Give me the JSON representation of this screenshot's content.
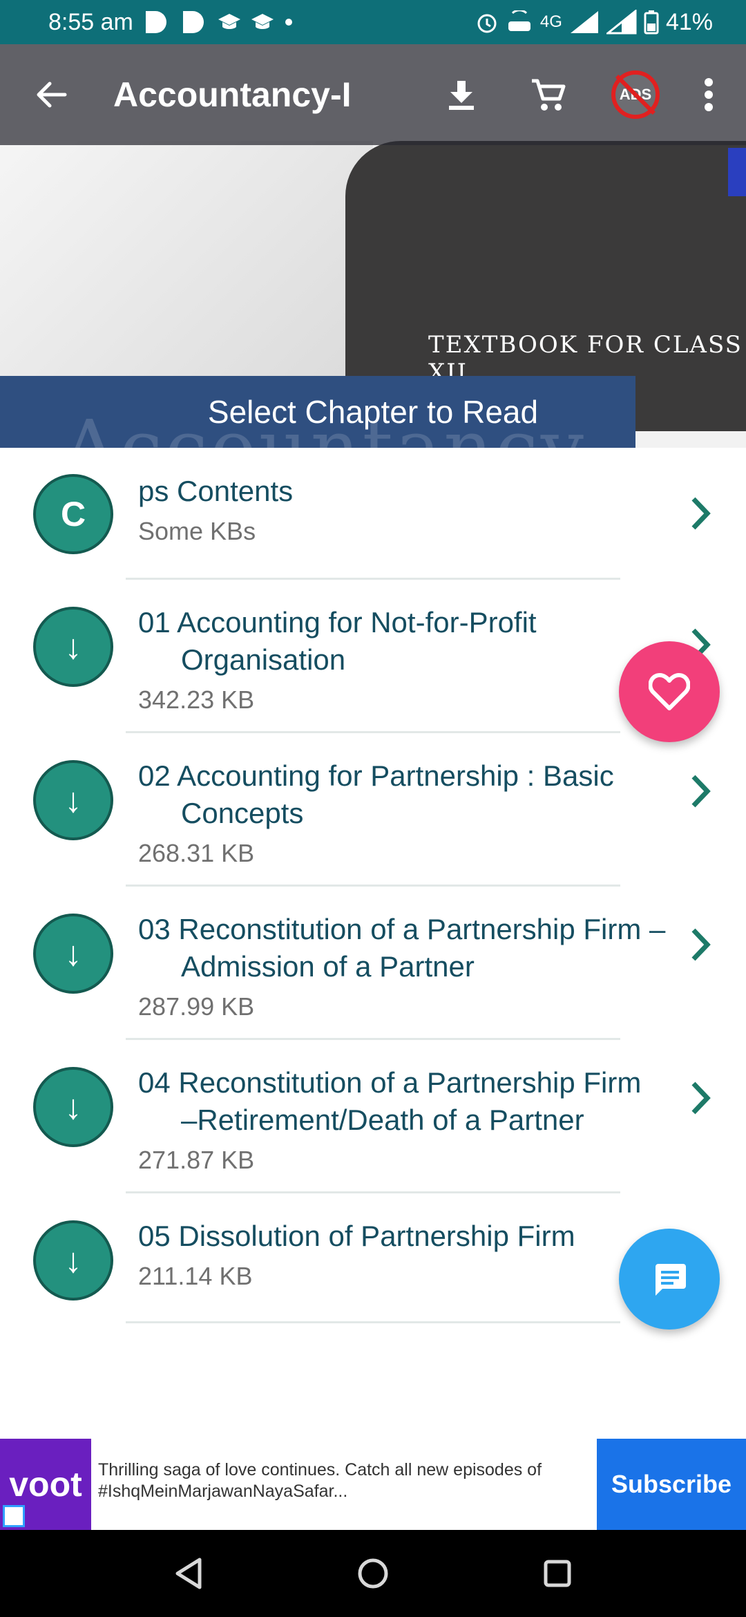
{
  "status_bar": {
    "time": "8:55 am",
    "battery": "41%",
    "network": "4G"
  },
  "toolbar": {
    "title": "Accountancy-I",
    "ads_label": "ADS"
  },
  "banner": {
    "caption": "TEXTBOOK FOR CLASS XII",
    "big_text": "Accountancy",
    "select_label": "Select Chapter to Read"
  },
  "chapters": [
    {
      "avatar": "C",
      "title": "ps Contents",
      "title_cont": "",
      "size": "Some KBs"
    },
    {
      "avatar": "↓",
      "title": "01 Accounting for Not-for-Profit",
      "title_cont": "Organisation",
      "size": "342.23 KB"
    },
    {
      "avatar": "↓",
      "title": "02 Accounting for Partnership : Basic",
      "title_cont": "Concepts",
      "size": "268.31 KB"
    },
    {
      "avatar": "↓",
      "title": "03 Reconstitution of a Partnership Firm –",
      "title_cont": "Admission of a Partner",
      "size": "287.99 KB"
    },
    {
      "avatar": "↓",
      "title": "04 Reconstitution of a Partnership Firm",
      "title_cont": "–Retirement/Death of a Partner",
      "size": "271.87 KB"
    },
    {
      "avatar": "↓",
      "title": "05 Dissolution of Partnership Firm",
      "title_cont": "",
      "size": "211.14 KB"
    }
  ],
  "ad": {
    "brand": "voot",
    "text": "Thrilling saga of love continues. Catch all new episodes of #IshqMeinMarjawanNayaSafar...",
    "cta": "Subscribe"
  },
  "colors": {
    "status_bar": "#0e6f78",
    "avatar": "#23917e",
    "title_text": "#154d60",
    "heart_fab": "#f23f7a",
    "chat_fab": "#2ea6f0",
    "ad_cta": "#1a73e8"
  }
}
